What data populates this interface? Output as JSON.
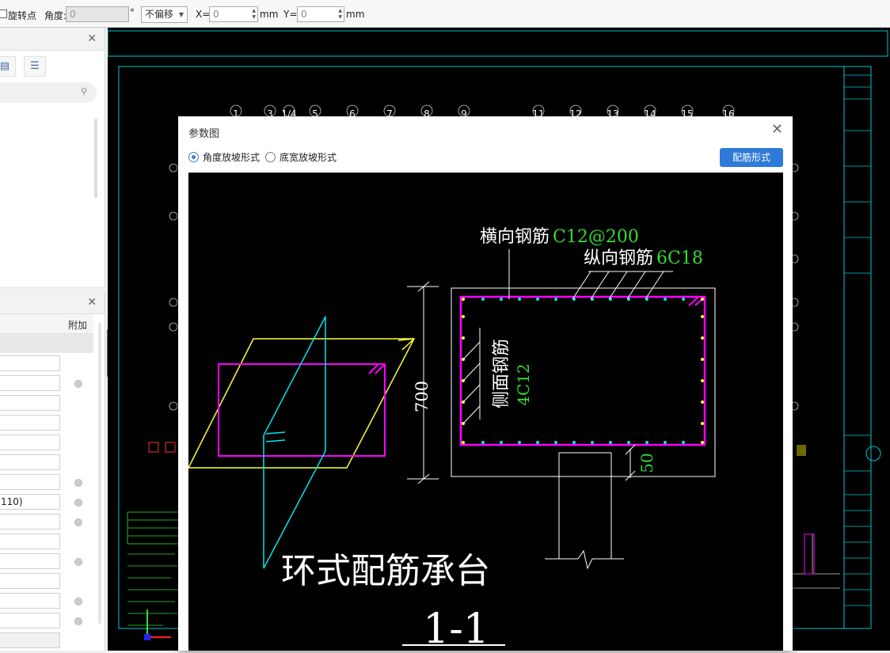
{
  "toolbar": {
    "rotate_label": "旋转点",
    "angle_label": "角度:",
    "angle_value": "0",
    "degree_symbol": "°",
    "offset_select": "不偏移",
    "x_label": "X=",
    "x_value": "0",
    "x_unit": "mm",
    "y_label": "Y=",
    "y_value": "0",
    "y_unit": "mm"
  },
  "panel2": {
    "col_header": "附加",
    "row_value": "110)"
  },
  "cad": {
    "axis_labels": [
      "1",
      "3",
      "1/4",
      "5",
      "6",
      "7",
      "8",
      "9",
      "11",
      "12",
      "13",
      "14",
      "15",
      "16"
    ]
  },
  "dialog": {
    "title": "参数图",
    "radio_angle": "角度放坡形式",
    "radio_width": "底宽放坡形式",
    "button": "配筋形式",
    "drawing": {
      "transverse_label": "横向钢筋",
      "transverse_value": "C12@200",
      "longitudinal_label": "纵向钢筋",
      "longitudinal_value": "6C18",
      "side_label": "侧面钢筋",
      "side_value": "4C12",
      "dim_height": "700",
      "dim_cover": "50",
      "caption": "环式配筋承台",
      "section": "1-1"
    }
  },
  "colors": {
    "accent": "#2f7ad8",
    "cad_cyan": "#00c8d2",
    "cad_magenta": "#ff00ff",
    "cad_yellow": "#ffff33",
    "cad_green": "#33dd33"
  }
}
